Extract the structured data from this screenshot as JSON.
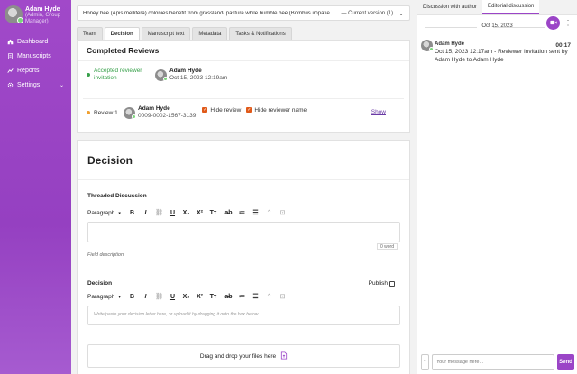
{
  "sidebar": {
    "user_name": "Adam Hyde",
    "user_role_line1": "(Admin, Group",
    "user_role_line2": "Manager)",
    "items": [
      {
        "label": "Dashboard",
        "icon": "home-icon"
      },
      {
        "label": "Manuscripts",
        "icon": "document-icon"
      },
      {
        "label": "Reports",
        "icon": "chart-line-icon"
      },
      {
        "label": "Settings",
        "icon": "gear-icon"
      }
    ]
  },
  "topbar": {
    "title": "Honey bee (Apis mellifera) colonies benefit from grassland/ pasture while bumble bee (Bombus impatiens) colonies in suburban landscapes...",
    "version": "— Current version (1)"
  },
  "tabs": [
    "Team",
    "Decision",
    "Manuscript text",
    "Metadata",
    "Tasks & Notifications"
  ],
  "reviews": {
    "heading": "Completed Reviews",
    "invitation_line1": "Accepted reviewer",
    "invitation_line2": "invitation",
    "invitee_name": "Adam Hyde",
    "invitee_date": "Oct 15, 2023 12:19am",
    "review_label": "Review 1",
    "reviewer_name": "Adam Hyde",
    "reviewer_orcid": "0009-0002-1567-3139",
    "hide_review": "Hide review",
    "hide_reviewer_name": "Hide reviewer name",
    "show": "Show"
  },
  "decision": {
    "heading": "Decision",
    "threaded_label": "Threaded Discussion",
    "paragraph": "Paragraph",
    "word_count": "0 word",
    "field_description": "Field description.",
    "decision_label": "Decision",
    "publish": "Publish",
    "placeholder": "Write/paste your decision letter here, or upload it by dragging it onto the box below.",
    "dropzone": "Drag and drop your files here"
  },
  "toolbar": [
    "B",
    "I",
    "⛓",
    "U",
    "X₂",
    "X²",
    "Tт",
    "a̶b",
    "≔",
    "☰",
    "⌃",
    "⊡"
  ],
  "chat": {
    "tabs": [
      "Discussion with author",
      "Editorial discussion"
    ],
    "date": "Oct 15, 2023",
    "message": {
      "author": "Adam Hyde",
      "time": "00:17",
      "body": "Oct 15, 2023 12:17am - Reviewer Invitation sent by Adam Hyde to Adam Hyde"
    },
    "input_placeholder": "Your message here...",
    "send": "Send"
  },
  "colors": {
    "accent": "#9b45c7",
    "checkbox": "#e05a1a",
    "success": "#37a04a",
    "pending": "#f0a030"
  }
}
